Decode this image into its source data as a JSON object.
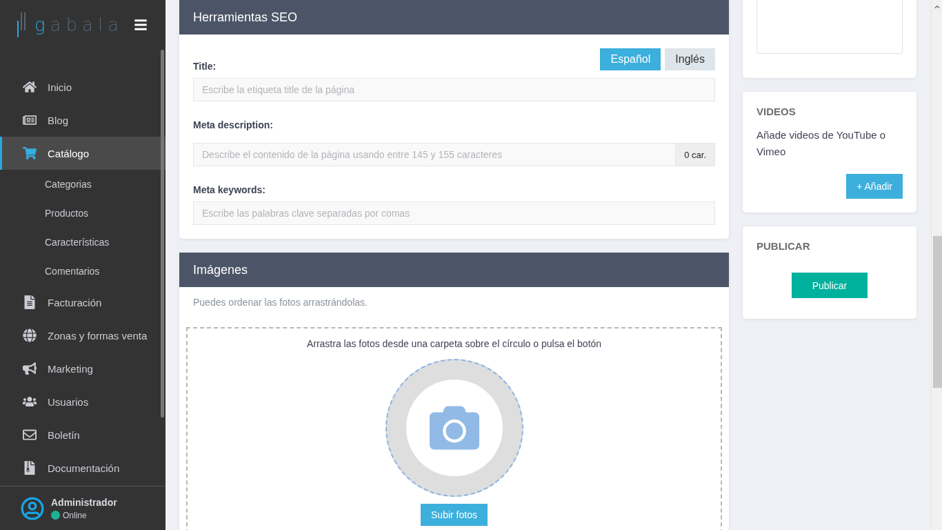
{
  "sidebar": {
    "logo": "gabala",
    "items": [
      {
        "label": "Inicio",
        "selected": false
      },
      {
        "label": "Blog",
        "selected": false
      },
      {
        "label": "Catálogo",
        "selected": true,
        "children": [
          {
            "label": "Categorias"
          },
          {
            "label": "Productos"
          },
          {
            "label": "Características"
          },
          {
            "label": "Comentarios"
          }
        ]
      },
      {
        "label": "Facturación",
        "selected": false
      },
      {
        "label": "Zonas y formas venta",
        "selected": false
      },
      {
        "label": "Marketing",
        "selected": false
      },
      {
        "label": "Usuarios",
        "selected": false
      },
      {
        "label": "Boletín",
        "selected": false
      },
      {
        "label": "Documentación",
        "selected": false
      }
    ],
    "user": {
      "name": "Administrador",
      "status": "Online"
    }
  },
  "seo": {
    "title": "Herramientas SEO",
    "languages": [
      {
        "label": "Español",
        "selected": true
      },
      {
        "label": "Inglés",
        "selected": false
      }
    ],
    "fields": [
      {
        "label": "Title:",
        "placeholder": "Escribe la etiqueta title de la página"
      },
      {
        "label": "Meta description:",
        "placeholder": "Describe el contenido de la página usando entre 145 y 155 caracteres",
        "counter": "0 car."
      },
      {
        "label": "Meta keywords:",
        "placeholder": "Escribe las palabras clave separadas por comas"
      }
    ]
  },
  "images": {
    "title": "Imágenes",
    "hint": "Puedes ordenar las fotos arrastrándolas.",
    "drop_text": "Arrastra las fotos desde una carpeta sobre el círculo o pulsa el botón",
    "button": "Subir fotos"
  },
  "videos": {
    "title": "VIDEOS",
    "text": "Añade videos de YouTube o Vimeo",
    "button": "+ Añadir"
  },
  "publish": {
    "title": "PUBLICAR",
    "button": "Publicar"
  }
}
